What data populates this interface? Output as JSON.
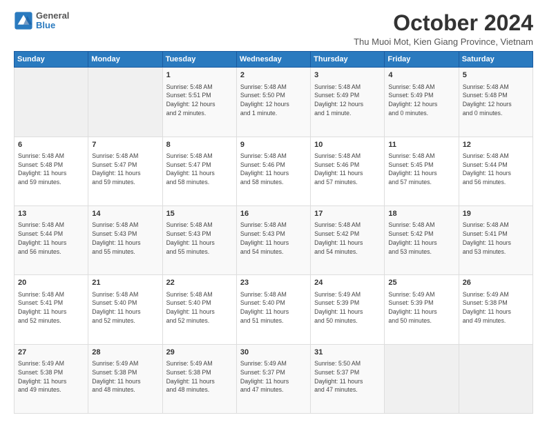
{
  "logo": {
    "line1": "General",
    "line2": "Blue"
  },
  "title": "October 2024",
  "location": "Thu Muoi Mot, Kien Giang Province, Vietnam",
  "days_header": [
    "Sunday",
    "Monday",
    "Tuesday",
    "Wednesday",
    "Thursday",
    "Friday",
    "Saturday"
  ],
  "weeks": [
    [
      {
        "day": "",
        "info": ""
      },
      {
        "day": "",
        "info": ""
      },
      {
        "day": "1",
        "info": "Sunrise: 5:48 AM\nSunset: 5:51 PM\nDaylight: 12 hours\nand 2 minutes."
      },
      {
        "day": "2",
        "info": "Sunrise: 5:48 AM\nSunset: 5:50 PM\nDaylight: 12 hours\nand 1 minute."
      },
      {
        "day": "3",
        "info": "Sunrise: 5:48 AM\nSunset: 5:49 PM\nDaylight: 12 hours\nand 1 minute."
      },
      {
        "day": "4",
        "info": "Sunrise: 5:48 AM\nSunset: 5:49 PM\nDaylight: 12 hours\nand 0 minutes."
      },
      {
        "day": "5",
        "info": "Sunrise: 5:48 AM\nSunset: 5:48 PM\nDaylight: 12 hours\nand 0 minutes."
      }
    ],
    [
      {
        "day": "6",
        "info": "Sunrise: 5:48 AM\nSunset: 5:48 PM\nDaylight: 11 hours\nand 59 minutes."
      },
      {
        "day": "7",
        "info": "Sunrise: 5:48 AM\nSunset: 5:47 PM\nDaylight: 11 hours\nand 59 minutes."
      },
      {
        "day": "8",
        "info": "Sunrise: 5:48 AM\nSunset: 5:47 PM\nDaylight: 11 hours\nand 58 minutes."
      },
      {
        "day": "9",
        "info": "Sunrise: 5:48 AM\nSunset: 5:46 PM\nDaylight: 11 hours\nand 58 minutes."
      },
      {
        "day": "10",
        "info": "Sunrise: 5:48 AM\nSunset: 5:46 PM\nDaylight: 11 hours\nand 57 minutes."
      },
      {
        "day": "11",
        "info": "Sunrise: 5:48 AM\nSunset: 5:45 PM\nDaylight: 11 hours\nand 57 minutes."
      },
      {
        "day": "12",
        "info": "Sunrise: 5:48 AM\nSunset: 5:44 PM\nDaylight: 11 hours\nand 56 minutes."
      }
    ],
    [
      {
        "day": "13",
        "info": "Sunrise: 5:48 AM\nSunset: 5:44 PM\nDaylight: 11 hours\nand 56 minutes."
      },
      {
        "day": "14",
        "info": "Sunrise: 5:48 AM\nSunset: 5:43 PM\nDaylight: 11 hours\nand 55 minutes."
      },
      {
        "day": "15",
        "info": "Sunrise: 5:48 AM\nSunset: 5:43 PM\nDaylight: 11 hours\nand 55 minutes."
      },
      {
        "day": "16",
        "info": "Sunrise: 5:48 AM\nSunset: 5:43 PM\nDaylight: 11 hours\nand 54 minutes."
      },
      {
        "day": "17",
        "info": "Sunrise: 5:48 AM\nSunset: 5:42 PM\nDaylight: 11 hours\nand 54 minutes."
      },
      {
        "day": "18",
        "info": "Sunrise: 5:48 AM\nSunset: 5:42 PM\nDaylight: 11 hours\nand 53 minutes."
      },
      {
        "day": "19",
        "info": "Sunrise: 5:48 AM\nSunset: 5:41 PM\nDaylight: 11 hours\nand 53 minutes."
      }
    ],
    [
      {
        "day": "20",
        "info": "Sunrise: 5:48 AM\nSunset: 5:41 PM\nDaylight: 11 hours\nand 52 minutes."
      },
      {
        "day": "21",
        "info": "Sunrise: 5:48 AM\nSunset: 5:40 PM\nDaylight: 11 hours\nand 52 minutes."
      },
      {
        "day": "22",
        "info": "Sunrise: 5:48 AM\nSunset: 5:40 PM\nDaylight: 11 hours\nand 52 minutes."
      },
      {
        "day": "23",
        "info": "Sunrise: 5:48 AM\nSunset: 5:40 PM\nDaylight: 11 hours\nand 51 minutes."
      },
      {
        "day": "24",
        "info": "Sunrise: 5:49 AM\nSunset: 5:39 PM\nDaylight: 11 hours\nand 50 minutes."
      },
      {
        "day": "25",
        "info": "Sunrise: 5:49 AM\nSunset: 5:39 PM\nDaylight: 11 hours\nand 50 minutes."
      },
      {
        "day": "26",
        "info": "Sunrise: 5:49 AM\nSunset: 5:38 PM\nDaylight: 11 hours\nand 49 minutes."
      }
    ],
    [
      {
        "day": "27",
        "info": "Sunrise: 5:49 AM\nSunset: 5:38 PM\nDaylight: 11 hours\nand 49 minutes."
      },
      {
        "day": "28",
        "info": "Sunrise: 5:49 AM\nSunset: 5:38 PM\nDaylight: 11 hours\nand 48 minutes."
      },
      {
        "day": "29",
        "info": "Sunrise: 5:49 AM\nSunset: 5:38 PM\nDaylight: 11 hours\nand 48 minutes."
      },
      {
        "day": "30",
        "info": "Sunrise: 5:49 AM\nSunset: 5:37 PM\nDaylight: 11 hours\nand 47 minutes."
      },
      {
        "day": "31",
        "info": "Sunrise: 5:50 AM\nSunset: 5:37 PM\nDaylight: 11 hours\nand 47 minutes."
      },
      {
        "day": "",
        "info": ""
      },
      {
        "day": "",
        "info": ""
      }
    ]
  ]
}
